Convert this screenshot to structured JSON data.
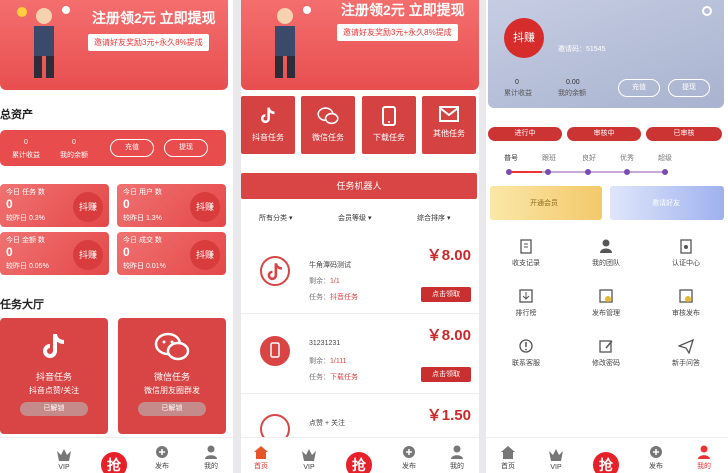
{
  "p1": {
    "banner_title": "注册领2元 立即提现",
    "banner_sub": "邀请好友奖励3元+永久8%提成",
    "assets_title": "总资产",
    "assets": {
      "earned_value": "0",
      "earned_label": "累计收益",
      "balance_value": "0",
      "balance_label": "我的余额",
      "recharge": "充值",
      "withdraw": "提现"
    },
    "stats": [
      {
        "label": "今日 任务 数",
        "value": "0",
        "compare": "较昨日 0.3%",
        "badge": "抖赚"
      },
      {
        "label": "今日 用户 数",
        "value": "0",
        "compare": "较昨日 1.3%",
        "badge": "抖赚"
      },
      {
        "label": "今日 金额 数",
        "value": "0",
        "compare": "较昨日 0.05%",
        "badge": "抖赚"
      },
      {
        "label": "今日 成交 数",
        "value": "0",
        "compare": "较昨日 0.01%",
        "badge": "抖赚"
      }
    ],
    "hall_title": "任务大厅",
    "cards": [
      {
        "title": "抖音任务",
        "sub": "抖音点赞/关注",
        "btn": "已解锁"
      },
      {
        "title": "微信任务",
        "sub": "微信朋友圈群发",
        "btn": "已解锁"
      }
    ]
  },
  "p2": {
    "banner_title": "注册领2元 立即提现",
    "banner_sub": "邀请好友奖励3元+永久8%提成",
    "tiles": [
      "抖音任务",
      "微信任务",
      "下载任务",
      "其他任务"
    ],
    "robot_btn": "任务机器人",
    "filters": [
      "所有分类",
      "会员等级",
      "综合排序"
    ],
    "tasks": [
      {
        "name": "牛角潭码测试",
        "price": "￥8.00",
        "remain_label": "剩余：",
        "remain": "1/1",
        "type_label": "任务：",
        "type": "抖音任务",
        "claim": "点击领取"
      },
      {
        "name": "31231231",
        "price": "￥8.00",
        "remain_label": "剩余：",
        "remain": "1/111",
        "type_label": "任务：",
        "type": "下载任务",
        "claim": "点击领取"
      },
      {
        "name": "点赞 + 关注",
        "price": "￥1.50"
      }
    ]
  },
  "p3": {
    "avatar_text": "抖赚",
    "user_id": "邀请码：51545",
    "earned_value": "0",
    "earned_label": "累计收益",
    "balance_value": "0.00",
    "balance_label": "我的余额",
    "recharge": "充值",
    "withdraw": "提现",
    "status_pills": [
      "进行中",
      "审核中",
      "已审核"
    ],
    "levels": [
      "普号",
      "跟班",
      "良好",
      "优秀",
      "超级"
    ],
    "open_member": "开通会员",
    "invite_friends": "邀请好友",
    "menu": [
      {
        "label": "收支记录",
        "icon": "clipboard-icon"
      },
      {
        "label": "我的团队",
        "icon": "team-icon"
      },
      {
        "label": "认证中心",
        "icon": "certificate-icon"
      },
      {
        "label": "排行榜",
        "icon": "ranking-icon"
      },
      {
        "label": "发布管理",
        "icon": "publish-manage-icon"
      },
      {
        "label": "审核发布",
        "icon": "review-icon"
      },
      {
        "label": "联系客服",
        "icon": "service-icon"
      },
      {
        "label": "修改密码",
        "icon": "edit-icon"
      },
      {
        "label": "新手问答",
        "icon": "send-icon"
      }
    ]
  },
  "nav": {
    "home": "首页",
    "vip": "VIP",
    "grab": "抢单",
    "grab_circle": "抢",
    "publish": "发布",
    "mine": "我的"
  },
  "colors": {
    "primary": "#e94c4c",
    "dark_red": "#c92f2f",
    "gold": "#f8d98a",
    "lavender": "#b7c6f2"
  }
}
